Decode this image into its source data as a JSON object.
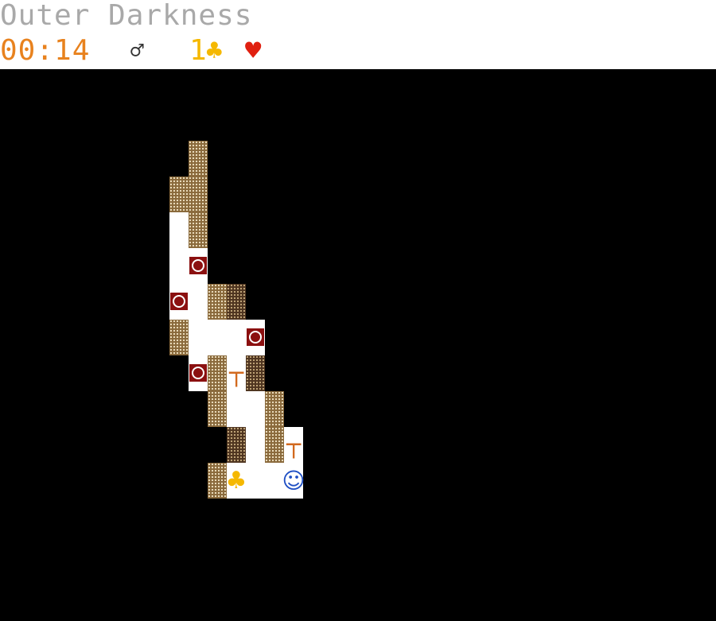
{
  "header": {
    "title": "Outer Darkness",
    "timer": "00:14",
    "gender_symbol": "♂",
    "clubs_count": "1",
    "clubs_symbol": "♣",
    "hearts_symbol": "♥"
  },
  "colors": {
    "title": "#a9a9a9",
    "timer": "#e8821e",
    "gender": "#333333",
    "clubs": "#f5b800",
    "hearts": "#e02010",
    "wall": "#8a6a3c",
    "wall_dark": "#4f3520",
    "floor": "#ffffff",
    "void": "#000000",
    "boulder": "#8b1010",
    "gate": "#d2691e",
    "player": "#1f4fc4"
  },
  "legend": {
    "W": "wall",
    "D": "wall-dark",
    ".": "floor",
    "O": "boulder-icon",
    "T": "gate-icon",
    "C": "club-icon",
    "@": "player-smiley-icon"
  },
  "glyphs": {
    "gate": "┬",
    "club": "♣",
    "player": "☺"
  },
  "map": {
    "grid": [
      "         ",
      "         ",
      "   W     ",
      "  WW     ",
      "  .W     ",
      "  .O     ",
      "  O.WD   ",
      "  W...O  ",
      "   OWTD  ",
      "    W..W ",
      "     D.WT",
      "    WC..@"
    ]
  }
}
